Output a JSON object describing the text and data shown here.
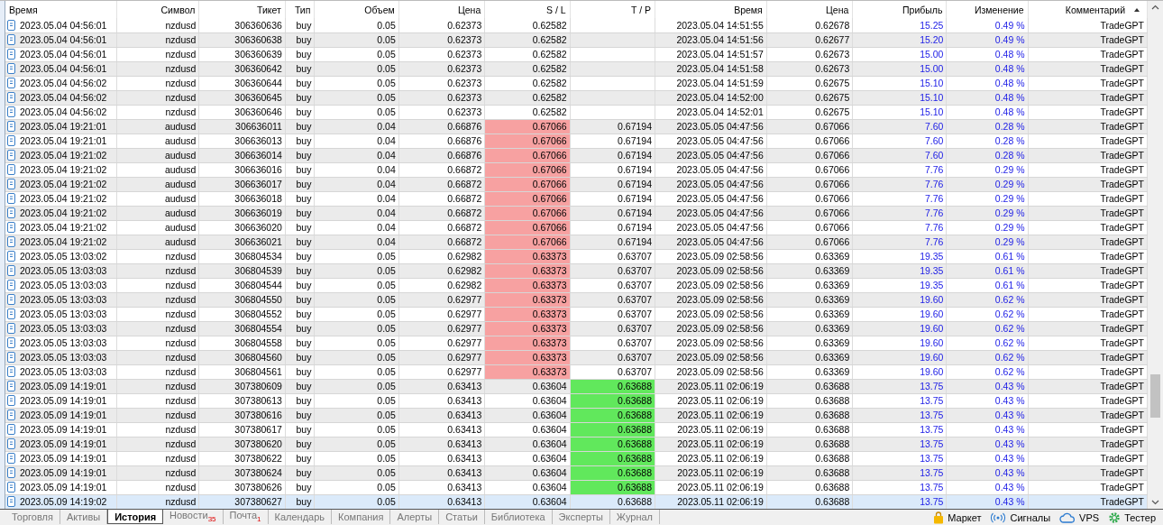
{
  "table": {
    "columns": [
      {
        "label": "Время",
        "sorted": false
      },
      {
        "label": "Символ",
        "sorted": false
      },
      {
        "label": "Тикет",
        "sorted": false
      },
      {
        "label": "Тип",
        "sorted": false
      },
      {
        "label": "Объем",
        "sorted": false
      },
      {
        "label": "Цена",
        "sorted": false
      },
      {
        "label": "S / L",
        "sorted": false
      },
      {
        "label": "T / P",
        "sorted": false
      },
      {
        "label": "Время",
        "sorted": false
      },
      {
        "label": "Цена",
        "sorted": false
      },
      {
        "label": "Прибыль",
        "sorted": false
      },
      {
        "label": "Изменение",
        "sorted": false
      },
      {
        "label": "Комментарий",
        "sorted": true
      }
    ],
    "rows": [
      {
        "time": "2023.05.04 04:56:01",
        "symbol": "nzdusd",
        "ticket": "306360636",
        "type": "buy",
        "volume": "0.05",
        "price": "0.62373",
        "sl": "0.62582",
        "close_time": "2023.05.04 14:51:55",
        "close_price": "0.62678",
        "profit": "15.25",
        "change": "0.49 %",
        "comment": "TradeGPT",
        "sl_hit": false,
        "tp_hit": false,
        "selected": false
      },
      {
        "time": "2023.05.04 04:56:01",
        "symbol": "nzdusd",
        "ticket": "306360638",
        "type": "buy",
        "volume": "0.05",
        "price": "0.62373",
        "sl": "0.62582",
        "close_time": "2023.05.04 14:51:56",
        "close_price": "0.62677",
        "profit": "15.20",
        "change": "0.49 %",
        "comment": "TradeGPT",
        "sl_hit": false,
        "tp_hit": false,
        "selected": false
      },
      {
        "time": "2023.05.04 04:56:01",
        "symbol": "nzdusd",
        "ticket": "306360639",
        "type": "buy",
        "volume": "0.05",
        "price": "0.62373",
        "sl": "0.62582",
        "close_time": "2023.05.04 14:51:57",
        "close_price": "0.62673",
        "profit": "15.00",
        "change": "0.48 %",
        "comment": "TradeGPT",
        "sl_hit": false,
        "tp_hit": false,
        "selected": false
      },
      {
        "time": "2023.05.04 04:56:01",
        "symbol": "nzdusd",
        "ticket": "306360642",
        "type": "buy",
        "volume": "0.05",
        "price": "0.62373",
        "sl": "0.62582",
        "close_time": "2023.05.04 14:51:58",
        "close_price": "0.62673",
        "profit": "15.00",
        "change": "0.48 %",
        "comment": "TradeGPT",
        "sl_hit": false,
        "tp_hit": false,
        "selected": false
      },
      {
        "time": "2023.05.04 04:56:02",
        "symbol": "nzdusd",
        "ticket": "306360644",
        "type": "buy",
        "volume": "0.05",
        "price": "0.62373",
        "sl": "0.62582",
        "close_time": "2023.05.04 14:51:59",
        "close_price": "0.62675",
        "profit": "15.10",
        "change": "0.48 %",
        "comment": "TradeGPT",
        "sl_hit": false,
        "tp_hit": false,
        "selected": false
      },
      {
        "time": "2023.05.04 04:56:02",
        "symbol": "nzdusd",
        "ticket": "306360645",
        "type": "buy",
        "volume": "0.05",
        "price": "0.62373",
        "sl": "0.62582",
        "close_time": "2023.05.04 14:52:00",
        "close_price": "0.62675",
        "profit": "15.10",
        "change": "0.48 %",
        "comment": "TradeGPT",
        "sl_hit": false,
        "tp_hit": false,
        "selected": false
      },
      {
        "time": "2023.05.04 04:56:02",
        "symbol": "nzdusd",
        "ticket": "306360646",
        "type": "buy",
        "volume": "0.05",
        "price": "0.62373",
        "sl": "0.62582",
        "close_time": "2023.05.04 14:52:01",
        "close_price": "0.62675",
        "profit": "15.10",
        "change": "0.48 %",
        "comment": "TradeGPT",
        "sl_hit": false,
        "tp_hit": false,
        "selected": false
      },
      {
        "time": "2023.05.04 19:21:01",
        "symbol": "audusd",
        "ticket": "306636011",
        "type": "buy",
        "volume": "0.04",
        "price": "0.66876",
        "sl": "0.67066",
        "tp": "0.67194",
        "close_time": "2023.05.05 04:47:56",
        "close_price": "0.67066",
        "profit": "7.60",
        "change": "0.28 %",
        "comment": "TradeGPT",
        "sl_hit": true,
        "tp_hit": false,
        "selected": false
      },
      {
        "time": "2023.05.04 19:21:01",
        "symbol": "audusd",
        "ticket": "306636013",
        "type": "buy",
        "volume": "0.04",
        "price": "0.66876",
        "sl": "0.67066",
        "tp": "0.67194",
        "close_time": "2023.05.05 04:47:56",
        "close_price": "0.67066",
        "profit": "7.60",
        "change": "0.28 %",
        "comment": "TradeGPT",
        "sl_hit": true,
        "tp_hit": false,
        "selected": false
      },
      {
        "time": "2023.05.04 19:21:02",
        "symbol": "audusd",
        "ticket": "306636014",
        "type": "buy",
        "volume": "0.04",
        "price": "0.66876",
        "sl": "0.67066",
        "tp": "0.67194",
        "close_time": "2023.05.05 04:47:56",
        "close_price": "0.67066",
        "profit": "7.60",
        "change": "0.28 %",
        "comment": "TradeGPT",
        "sl_hit": true,
        "tp_hit": false,
        "selected": false
      },
      {
        "time": "2023.05.04 19:21:02",
        "symbol": "audusd",
        "ticket": "306636016",
        "type": "buy",
        "volume": "0.04",
        "price": "0.66872",
        "sl": "0.67066",
        "tp": "0.67194",
        "close_time": "2023.05.05 04:47:56",
        "close_price": "0.67066",
        "profit": "7.76",
        "change": "0.29 %",
        "comment": "TradeGPT",
        "sl_hit": true,
        "tp_hit": false,
        "selected": false
      },
      {
        "time": "2023.05.04 19:21:02",
        "symbol": "audusd",
        "ticket": "306636017",
        "type": "buy",
        "volume": "0.04",
        "price": "0.66872",
        "sl": "0.67066",
        "tp": "0.67194",
        "close_time": "2023.05.05 04:47:56",
        "close_price": "0.67066",
        "profit": "7.76",
        "change": "0.29 %",
        "comment": "TradeGPT",
        "sl_hit": true,
        "tp_hit": false,
        "selected": false
      },
      {
        "time": "2023.05.04 19:21:02",
        "symbol": "audusd",
        "ticket": "306636018",
        "type": "buy",
        "volume": "0.04",
        "price": "0.66872",
        "sl": "0.67066",
        "tp": "0.67194",
        "close_time": "2023.05.05 04:47:56",
        "close_price": "0.67066",
        "profit": "7.76",
        "change": "0.29 %",
        "comment": "TradeGPT",
        "sl_hit": true,
        "tp_hit": false,
        "selected": false
      },
      {
        "time": "2023.05.04 19:21:02",
        "symbol": "audusd",
        "ticket": "306636019",
        "type": "buy",
        "volume": "0.04",
        "price": "0.66872",
        "sl": "0.67066",
        "tp": "0.67194",
        "close_time": "2023.05.05 04:47:56",
        "close_price": "0.67066",
        "profit": "7.76",
        "change": "0.29 %",
        "comment": "TradeGPT",
        "sl_hit": true,
        "tp_hit": false,
        "selected": false
      },
      {
        "time": "2023.05.04 19:21:02",
        "symbol": "audusd",
        "ticket": "306636020",
        "type": "buy",
        "volume": "0.04",
        "price": "0.66872",
        "sl": "0.67066",
        "tp": "0.67194",
        "close_time": "2023.05.05 04:47:56",
        "close_price": "0.67066",
        "profit": "7.76",
        "change": "0.29 %",
        "comment": "TradeGPT",
        "sl_hit": true,
        "tp_hit": false,
        "selected": false
      },
      {
        "time": "2023.05.04 19:21:02",
        "symbol": "audusd",
        "ticket": "306636021",
        "type": "buy",
        "volume": "0.04",
        "price": "0.66872",
        "sl": "0.67066",
        "tp": "0.67194",
        "close_time": "2023.05.05 04:47:56",
        "close_price": "0.67066",
        "profit": "7.76",
        "change": "0.29 %",
        "comment": "TradeGPT",
        "sl_hit": true,
        "tp_hit": false,
        "selected": false
      },
      {
        "time": "2023.05.05 13:03:02",
        "symbol": "nzdusd",
        "ticket": "306804534",
        "type": "buy",
        "volume": "0.05",
        "price": "0.62982",
        "sl": "0.63373",
        "tp": "0.63707",
        "close_time": "2023.05.09 02:58:56",
        "close_price": "0.63369",
        "profit": "19.35",
        "change": "0.61 %",
        "comment": "TradeGPT",
        "sl_hit": true,
        "tp_hit": false,
        "selected": false
      },
      {
        "time": "2023.05.05 13:03:03",
        "symbol": "nzdusd",
        "ticket": "306804539",
        "type": "buy",
        "volume": "0.05",
        "price": "0.62982",
        "sl": "0.63373",
        "tp": "0.63707",
        "close_time": "2023.05.09 02:58:56",
        "close_price": "0.63369",
        "profit": "19.35",
        "change": "0.61 %",
        "comment": "TradeGPT",
        "sl_hit": true,
        "tp_hit": false,
        "selected": false
      },
      {
        "time": "2023.05.05 13:03:03",
        "symbol": "nzdusd",
        "ticket": "306804544",
        "type": "buy",
        "volume": "0.05",
        "price": "0.62982",
        "sl": "0.63373",
        "tp": "0.63707",
        "close_time": "2023.05.09 02:58:56",
        "close_price": "0.63369",
        "profit": "19.35",
        "change": "0.61 %",
        "comment": "TradeGPT",
        "sl_hit": true,
        "tp_hit": false,
        "selected": false
      },
      {
        "time": "2023.05.05 13:03:03",
        "symbol": "nzdusd",
        "ticket": "306804550",
        "type": "buy",
        "volume": "0.05",
        "price": "0.62977",
        "sl": "0.63373",
        "tp": "0.63707",
        "close_time": "2023.05.09 02:58:56",
        "close_price": "0.63369",
        "profit": "19.60",
        "change": "0.62 %",
        "comment": "TradeGPT",
        "sl_hit": true,
        "tp_hit": false,
        "selected": false
      },
      {
        "time": "2023.05.05 13:03:03",
        "symbol": "nzdusd",
        "ticket": "306804552",
        "type": "buy",
        "volume": "0.05",
        "price": "0.62977",
        "sl": "0.63373",
        "tp": "0.63707",
        "close_time": "2023.05.09 02:58:56",
        "close_price": "0.63369",
        "profit": "19.60",
        "change": "0.62 %",
        "comment": "TradeGPT",
        "sl_hit": true,
        "tp_hit": false,
        "selected": false
      },
      {
        "time": "2023.05.05 13:03:03",
        "symbol": "nzdusd",
        "ticket": "306804554",
        "type": "buy",
        "volume": "0.05",
        "price": "0.62977",
        "sl": "0.63373",
        "tp": "0.63707",
        "close_time": "2023.05.09 02:58:56",
        "close_price": "0.63369",
        "profit": "19.60",
        "change": "0.62 %",
        "comment": "TradeGPT",
        "sl_hit": true,
        "tp_hit": false,
        "selected": false
      },
      {
        "time": "2023.05.05 13:03:03",
        "symbol": "nzdusd",
        "ticket": "306804558",
        "type": "buy",
        "volume": "0.05",
        "price": "0.62977",
        "sl": "0.63373",
        "tp": "0.63707",
        "close_time": "2023.05.09 02:58:56",
        "close_price": "0.63369",
        "profit": "19.60",
        "change": "0.62 %",
        "comment": "TradeGPT",
        "sl_hit": true,
        "tp_hit": false,
        "selected": false
      },
      {
        "time": "2023.05.05 13:03:03",
        "symbol": "nzdusd",
        "ticket": "306804560",
        "type": "buy",
        "volume": "0.05",
        "price": "0.62977",
        "sl": "0.63373",
        "tp": "0.63707",
        "close_time": "2023.05.09 02:58:56",
        "close_price": "0.63369",
        "profit": "19.60",
        "change": "0.62 %",
        "comment": "TradeGPT",
        "sl_hit": true,
        "tp_hit": false,
        "selected": false
      },
      {
        "time": "2023.05.05 13:03:03",
        "symbol": "nzdusd",
        "ticket": "306804561",
        "type": "buy",
        "volume": "0.05",
        "price": "0.62977",
        "sl": "0.63373",
        "tp": "0.63707",
        "close_time": "2023.05.09 02:58:56",
        "close_price": "0.63369",
        "profit": "19.60",
        "change": "0.62 %",
        "comment": "TradeGPT",
        "sl_hit": true,
        "tp_hit": false,
        "selected": false
      },
      {
        "time": "2023.05.09 14:19:01",
        "symbol": "nzdusd",
        "ticket": "307380609",
        "type": "buy",
        "volume": "0.05",
        "price": "0.63413",
        "sl": "0.63604",
        "tp": "0.63688",
        "close_time": "2023.05.11 02:06:19",
        "close_price": "0.63688",
        "profit": "13.75",
        "change": "0.43 %",
        "comment": "TradeGPT",
        "sl_hit": false,
        "tp_hit": true,
        "selected": false
      },
      {
        "time": "2023.05.09 14:19:01",
        "symbol": "nzdusd",
        "ticket": "307380613",
        "type": "buy",
        "volume": "0.05",
        "price": "0.63413",
        "sl": "0.63604",
        "tp": "0.63688",
        "close_time": "2023.05.11 02:06:19",
        "close_price": "0.63688",
        "profit": "13.75",
        "change": "0.43 %",
        "comment": "TradeGPT",
        "sl_hit": false,
        "tp_hit": true,
        "selected": false
      },
      {
        "time": "2023.05.09 14:19:01",
        "symbol": "nzdusd",
        "ticket": "307380616",
        "type": "buy",
        "volume": "0.05",
        "price": "0.63413",
        "sl": "0.63604",
        "tp": "0.63688",
        "close_time": "2023.05.11 02:06:19",
        "close_price": "0.63688",
        "profit": "13.75",
        "change": "0.43 %",
        "comment": "TradeGPT",
        "sl_hit": false,
        "tp_hit": true,
        "selected": false
      },
      {
        "time": "2023.05.09 14:19:01",
        "symbol": "nzdusd",
        "ticket": "307380617",
        "type": "buy",
        "volume": "0.05",
        "price": "0.63413",
        "sl": "0.63604",
        "tp": "0.63688",
        "close_time": "2023.05.11 02:06:19",
        "close_price": "0.63688",
        "profit": "13.75",
        "change": "0.43 %",
        "comment": "TradeGPT",
        "sl_hit": false,
        "tp_hit": true,
        "selected": false
      },
      {
        "time": "2023.05.09 14:19:01",
        "symbol": "nzdusd",
        "ticket": "307380620",
        "type": "buy",
        "volume": "0.05",
        "price": "0.63413",
        "sl": "0.63604",
        "tp": "0.63688",
        "close_time": "2023.05.11 02:06:19",
        "close_price": "0.63688",
        "profit": "13.75",
        "change": "0.43 %",
        "comment": "TradeGPT",
        "sl_hit": false,
        "tp_hit": true,
        "selected": false
      },
      {
        "time": "2023.05.09 14:19:01",
        "symbol": "nzdusd",
        "ticket": "307380622",
        "type": "buy",
        "volume": "0.05",
        "price": "0.63413",
        "sl": "0.63604",
        "tp": "0.63688",
        "close_time": "2023.05.11 02:06:19",
        "close_price": "0.63688",
        "profit": "13.75",
        "change": "0.43 %",
        "comment": "TradeGPT",
        "sl_hit": false,
        "tp_hit": true,
        "selected": false
      },
      {
        "time": "2023.05.09 14:19:01",
        "symbol": "nzdusd",
        "ticket": "307380624",
        "type": "buy",
        "volume": "0.05",
        "price": "0.63413",
        "sl": "0.63604",
        "tp": "0.63688",
        "close_time": "2023.05.11 02:06:19",
        "close_price": "0.63688",
        "profit": "13.75",
        "change": "0.43 %",
        "comment": "TradeGPT",
        "sl_hit": false,
        "tp_hit": true,
        "selected": false
      },
      {
        "time": "2023.05.09 14:19:01",
        "symbol": "nzdusd",
        "ticket": "307380626",
        "type": "buy",
        "volume": "0.05",
        "price": "0.63413",
        "sl": "0.63604",
        "tp": "0.63688",
        "close_time": "2023.05.11 02:06:19",
        "close_price": "0.63688",
        "profit": "13.75",
        "change": "0.43 %",
        "comment": "TradeGPT",
        "sl_hit": false,
        "tp_hit": true,
        "selected": false
      },
      {
        "time": "2023.05.09 14:19:02",
        "symbol": "nzdusd",
        "ticket": "307380627",
        "type": "buy",
        "volume": "0.05",
        "price": "0.63413",
        "sl": "0.63604",
        "tp": "0.63688",
        "close_time": "2023.05.11 02:06:19",
        "close_price": "0.63688",
        "profit": "13.75",
        "change": "0.43 %",
        "comment": "TradeGPT",
        "sl_hit": false,
        "tp_hit": false,
        "selected": true
      }
    ]
  },
  "bottom_tabs": [
    {
      "label": "Торговля",
      "selected": false
    },
    {
      "label": "Активы",
      "selected": false
    },
    {
      "label": "История",
      "selected": true
    },
    {
      "label": "Новости",
      "badge": "35",
      "selected": false
    },
    {
      "label": "Почта",
      "badge": "1",
      "selected": false
    },
    {
      "label": "Календарь",
      "selected": false
    },
    {
      "label": "Компания",
      "selected": false
    },
    {
      "label": "Алерты",
      "selected": false
    },
    {
      "label": "Статьи",
      "selected": false
    },
    {
      "label": "Библиотека",
      "selected": false
    },
    {
      "label": "Эксперты",
      "selected": false
    },
    {
      "label": "Журнал",
      "selected": false
    }
  ],
  "right_links": [
    {
      "kind": "market",
      "label": "Маркет"
    },
    {
      "kind": "signals",
      "label": "Сигналы"
    },
    {
      "kind": "vps",
      "label": "VPS"
    },
    {
      "kind": "tester",
      "label": "Тестер"
    }
  ]
}
